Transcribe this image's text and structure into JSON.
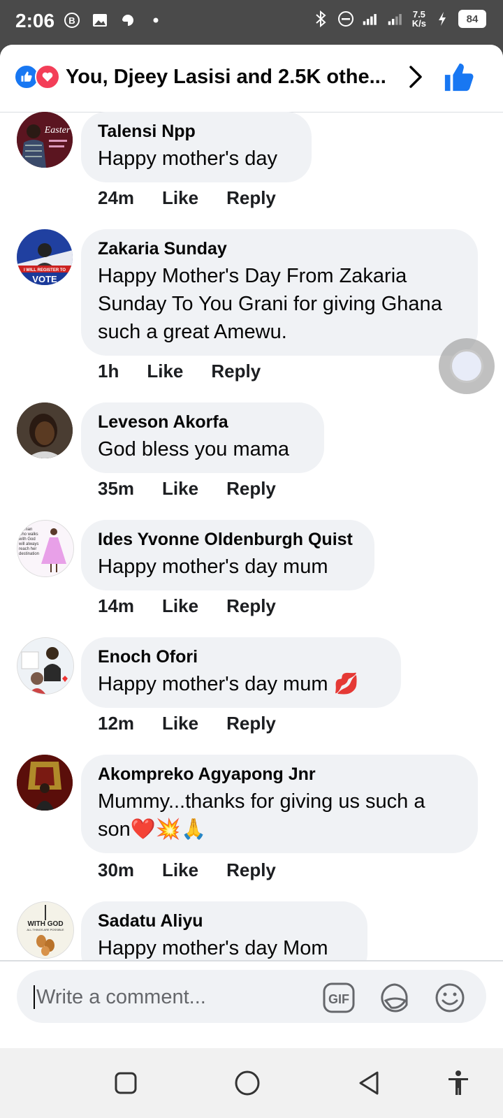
{
  "status_bar": {
    "time": "2:06",
    "net_speed_value": "7.5",
    "net_speed_unit": "K/s",
    "battery": "84"
  },
  "header": {
    "title": "You, Djeey Lasisi and 2.5K othe..."
  },
  "comments": [
    {
      "author": "Talensi Npp",
      "text": "Happy mother's day",
      "time": "24m",
      "like": "Like",
      "reply": "Reply",
      "avatar_color": "#5a1a22"
    },
    {
      "author": "Zakaria Sunday",
      "text": "Happy Mother's Day From Zakaria Sunday To You Grani for giving Ghana such a great Amewu.",
      "time": "1h",
      "like": "Like",
      "reply": "Reply",
      "avatar_color": "#2a4aa0"
    },
    {
      "author": "Leveson Akorfa",
      "text": "God bless you mama",
      "time": "35m",
      "like": "Like",
      "reply": "Reply",
      "avatar_color": "#3a2a1a"
    },
    {
      "author": "Ides Yvonne Oldenburgh Quist",
      "text": "Happy mother's day mum",
      "time": "14m",
      "like": "Like",
      "reply": "Reply",
      "avatar_color": "#e9d0ea"
    },
    {
      "author": "Enoch Ofori",
      "text": "Happy mother's day mum 💋",
      "time": "12m",
      "like": "Like",
      "reply": "Reply",
      "avatar_color": "#d8e0e8"
    },
    {
      "author": "Akompreko Agyapong Jnr",
      "text": "Mummy...thanks for giving us such a son❤️💥🙏",
      "time": "30m",
      "like": "Like",
      "reply": "Reply",
      "avatar_color": "#6a1a10"
    },
    {
      "author": "Sadatu Aliyu",
      "text": "Happy mother's day Mom",
      "avatar_color": "#d8d8c8"
    }
  ],
  "avatar_texts": {
    "talensi": "Easter",
    "zakaria_banner": "I WILL REGISTER TO",
    "zakaria_vote": "VOTE",
    "ides": "woman who walks with God will always reach her destination",
    "sadatu_1": "WITH GOD",
    "sadatu_2": "ALL THINGS ARE POSSIBLE"
  },
  "composer": {
    "placeholder": "Write a comment...",
    "gif_label": "GIF"
  },
  "colors": {
    "brand_blue": "#1877f2",
    "love_red": "#f33e58",
    "bubble_gray": "#f0f2f5",
    "status_bar": "#4a4a4a"
  },
  "icons": {
    "like": "thumbs-up-icon",
    "love": "heart-icon",
    "chevron": "chevron-right-icon",
    "sticker": "sticker-icon",
    "emoji": "emoji-icon"
  }
}
